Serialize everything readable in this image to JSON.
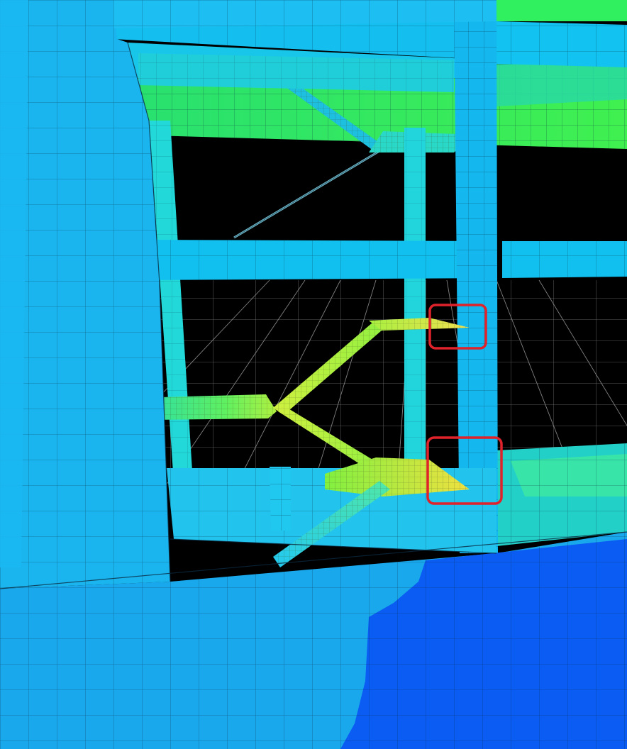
{
  "viewport": {
    "description_hidden": "",
    "colors": {
      "background": "#000000",
      "wall_cyan": "#19b6f0",
      "wall_light": "#27c4f4",
      "beam": "#13c9f0",
      "column_teal": "#1ee0c8",
      "slab_green": "#2ef060",
      "stair_yellow": "#c8f020",
      "deep_blue": "#0a5cf2",
      "mesh_line": "#0b2a40",
      "grid_line": "#9a9a9a",
      "highlight_red": "#e0222a"
    },
    "highlights": [
      {
        "name": "highlight-box-upper-landing"
      },
      {
        "name": "highlight-box-lower-landing"
      }
    ]
  }
}
